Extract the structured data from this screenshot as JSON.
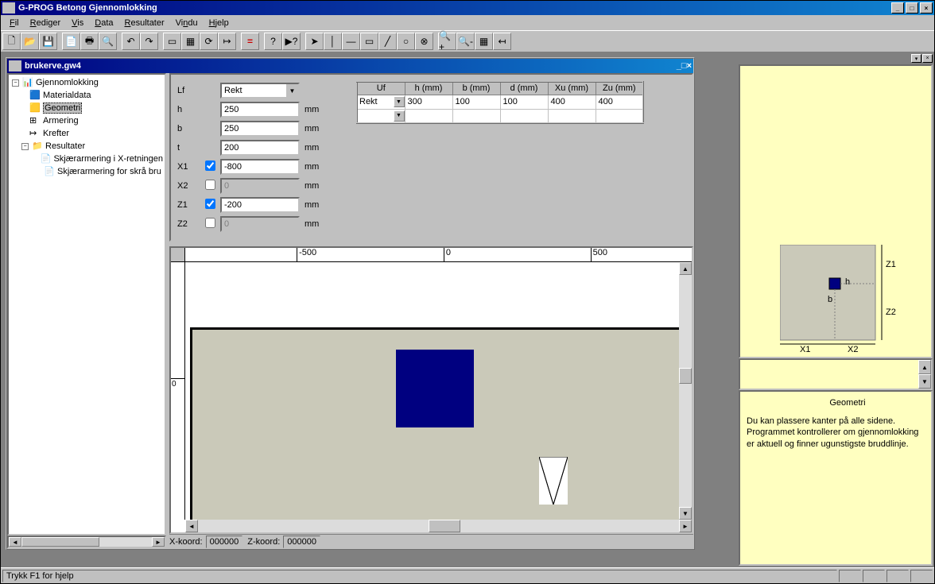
{
  "app_title": "G-PROG Betong Gjennomlokking",
  "menubar": [
    "Fil",
    "Rediger",
    "Vis",
    "Data",
    "Resultater",
    "Vindu",
    "Hjelp"
  ],
  "document_title": "brukerve.gw4",
  "tree": {
    "root": "Gjennomlokking",
    "items": [
      "Materialdata",
      "Geometri",
      "Armering",
      "Krefter"
    ],
    "results_label": "Resultater",
    "results_items": [
      "Skjærarmering i X-retningen",
      "Skjærarmering for skrå bru"
    ]
  },
  "form": {
    "Lf": {
      "label": "Lf",
      "value": "Rekt"
    },
    "h": {
      "label": "h",
      "value": "250",
      "unit": "mm"
    },
    "b": {
      "label": "b",
      "value": "250",
      "unit": "mm"
    },
    "t": {
      "label": "t",
      "value": "200",
      "unit": "mm"
    },
    "X1": {
      "label": "X1",
      "checked": true,
      "value": "-800",
      "unit": "mm"
    },
    "X2": {
      "label": "X2",
      "checked": false,
      "value": "0",
      "unit": "mm"
    },
    "Z1": {
      "label": "Z1",
      "checked": true,
      "value": "-200",
      "unit": "mm"
    },
    "Z2": {
      "label": "Z2",
      "checked": false,
      "value": "0",
      "unit": "mm"
    }
  },
  "table": {
    "headers": [
      "Uf",
      "h (mm)",
      "b (mm)",
      "d (mm)",
      "Xu (mm)",
      "Zu (mm)"
    ],
    "row1": {
      "uf": "Rekt",
      "h": "300",
      "b": "100",
      "d": "100",
      "xu": "400",
      "zu": "400"
    }
  },
  "ruler": {
    "neg500": "-500",
    "zero": "0",
    "pos500": "500",
    "v0": "0"
  },
  "coord": {
    "x_label": "X-koord:",
    "x_value": "000000",
    "z_label": "Z-koord:",
    "z_value": "000000"
  },
  "schematic": {
    "x1": "X1",
    "x2": "X2",
    "z1": "Z1",
    "z2": "Z2",
    "b": "b",
    "h": "h"
  },
  "help": {
    "title": "Geometri",
    "body": "Du kan plassere kanter på alle sidene. Programmet kontrollerer om gjennomlokking er aktuell og finner ugunstigste bruddlinje."
  },
  "status": "Trykk F1 for hjelp"
}
